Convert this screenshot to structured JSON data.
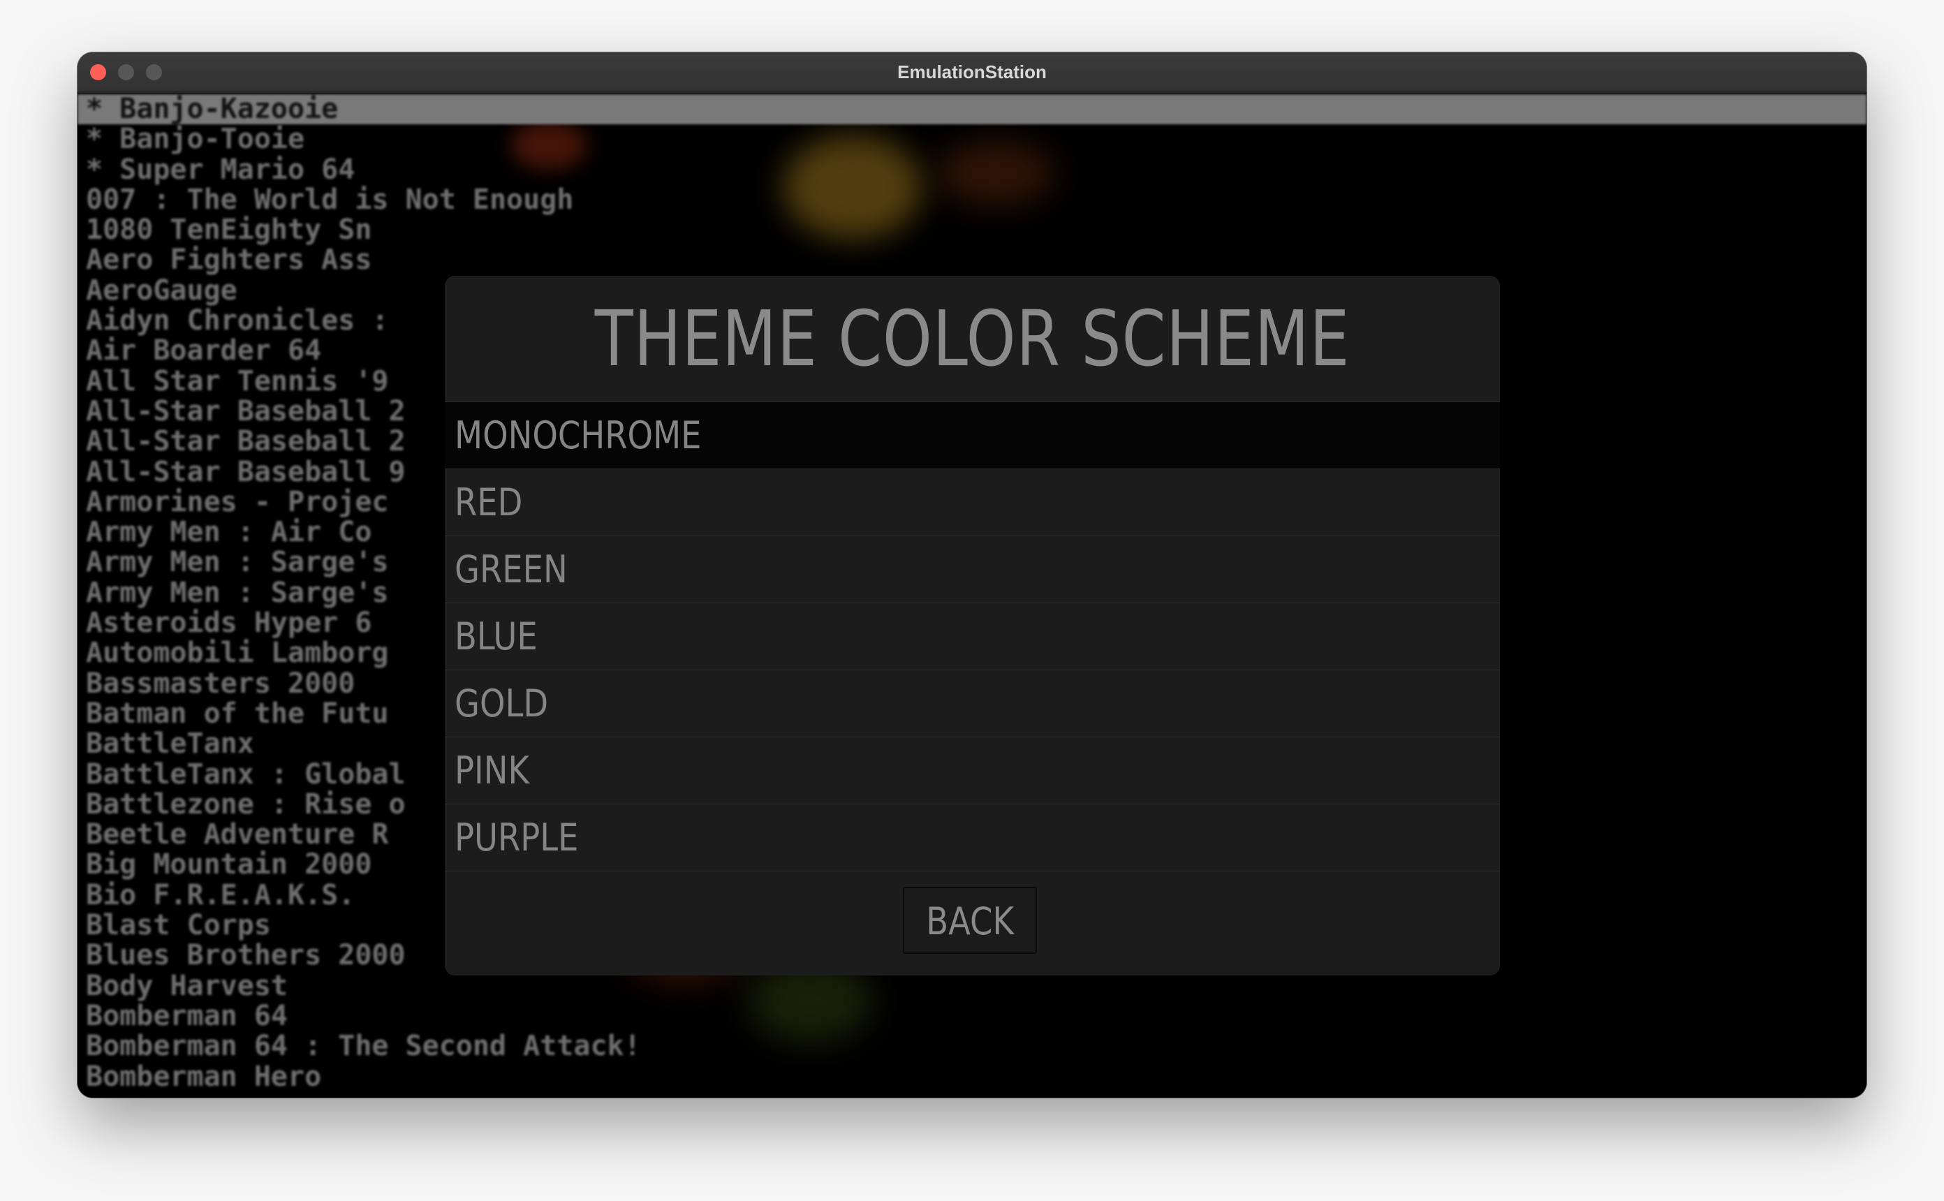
{
  "window": {
    "title": "EmulationStation"
  },
  "game_list": {
    "selected_index": 0,
    "items": [
      "* Banjo-Kazooie",
      "* Banjo-Tooie",
      "* Super Mario 64",
      "007 : The World is Not Enough",
      "1080 TenEighty Sn",
      "Aero Fighters Ass",
      "AeroGauge",
      "Aidyn Chronicles :",
      "Air Boarder 64",
      "All Star Tennis '9",
      "All-Star Baseball 2",
      "All-Star Baseball 2",
      "All-Star Baseball 9",
      "Armorines - Projec",
      "Army Men : Air Co",
      "Army Men : Sarge's",
      "Army Men : Sarge's",
      "Asteroids Hyper 6",
      "Automobili Lamborg",
      "Bassmasters 2000",
      "Batman of the Futu",
      "BattleTanx",
      "BattleTanx : Global",
      "Battlezone : Rise o",
      "Beetle Adventure R",
      "Big Mountain 2000",
      "Bio F.R.E.A.K.S.",
      "Blast Corps",
      "Blues Brothers 2000",
      "Body Harvest",
      "Bomberman 64",
      "Bomberman 64 : The Second Attack!",
      "Bomberman Hero"
    ]
  },
  "menu": {
    "title": "THEME COLOR SCHEME",
    "selected_index": 0,
    "options": [
      "MONOCHROME",
      "RED",
      "GREEN",
      "BLUE",
      "GOLD",
      "PINK",
      "PURPLE"
    ],
    "back_label": "BACK"
  },
  "colors": {
    "menu_background": "#1c1c1c",
    "menu_text": "#858585",
    "selected_row": "#050505",
    "list_highlight": "#a8a8a8"
  }
}
